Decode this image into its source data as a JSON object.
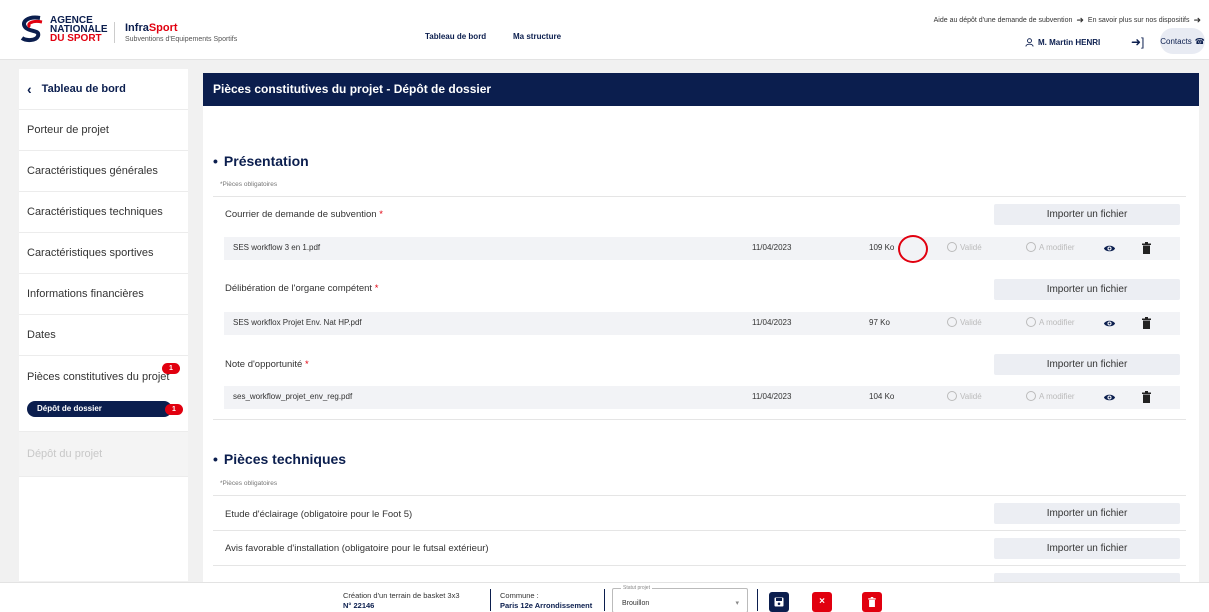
{
  "header": {
    "logo_line1": "AGENCE",
    "logo_line2": "NATIONALE",
    "logo_line3": "DU SPORT",
    "brand_name_part1": "Infra",
    "brand_name_part2": "Sport",
    "brand_sub": "Subventions d'Equipements Sportifs",
    "nav": [
      "Tableau de bord",
      "Ma structure"
    ],
    "top_link1": "Aide au dépôt d'une demande de subvention",
    "top_link2": "En savoir plus sur nos dispositifs",
    "user": "M. Martin HENRI",
    "contacts": "Contacts"
  },
  "sidebar": {
    "back": "Tableau de bord",
    "items": [
      "Porteur de projet",
      "Caractéristiques générales",
      "Caractéristiques techniques",
      "Caractéristiques sportives",
      "Informations financières",
      "Dates"
    ],
    "pieces_label": "Pièces constitutives du projet",
    "pieces_badge": "1",
    "sub_item": "Dépôt de dossier",
    "sub_badge": "1",
    "disabled_item": "Dépôt du projet"
  },
  "main": {
    "title": "Pièces constitutives du projet - Dépôt de dossier",
    "import_label": "Importer un fichier",
    "valid_label": "Validé",
    "modify_label": "A modifier",
    "presentation": {
      "title": "Présentation",
      "oblig": "*Pièces obligatoires",
      "docs": [
        {
          "label": "Courrier de demande de subvention",
          "required": "*",
          "file": "SES workflow 3 en 1.pdf",
          "date": "11/04/2023",
          "size": "109 Ko"
        },
        {
          "label": "Délibération de l'organe compétent",
          "required": "*",
          "file": "SES workflox Projet Env. Nat HP.pdf",
          "date": "11/04/2023",
          "size": "97 Ko"
        },
        {
          "label": "Note d'opportunité",
          "required": "*",
          "file": "ses_workflow_projet_env_reg.pdf",
          "date": "11/04/2023",
          "size": "104 Ko"
        }
      ]
    },
    "techniques": {
      "title": "Pièces techniques",
      "oblig": "*Pièces obligatoires",
      "docs": [
        {
          "label": "Etude d'éclairage (obligatoire pour le Foot 5)"
        },
        {
          "label": "Avis favorable d'installation (obligatoire pour le futsal extérieur)"
        }
      ]
    }
  },
  "footer": {
    "project_name": "Création d'un terrain de basket 3x3",
    "project_num": "N° 22146",
    "commune_label": "Commune :",
    "commune_value": "Paris 12e Arrondissement",
    "status_label": "Statut projet",
    "status_value": "Brouillon"
  },
  "colors": {
    "navy": "#0b1e4e",
    "red": "#e1000f"
  }
}
